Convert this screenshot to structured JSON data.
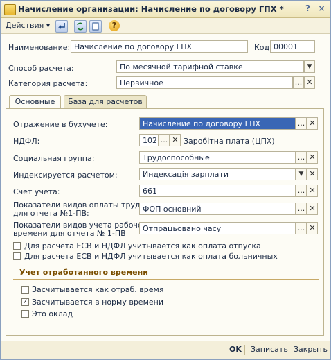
{
  "window": {
    "title": "Начисление организации: Начисление по договору ГПХ *",
    "controls": {
      "help": "?",
      "close": "×"
    }
  },
  "toolbar": {
    "actions_label": "Действия",
    "actions_arrow": "▾",
    "help_glyph": "?"
  },
  "header": {
    "name_label": "Наименование:",
    "name_value": "Начисление по договору ГПХ",
    "code_label": "Код:",
    "code_value": "00001",
    "calc_method_label": "Способ расчета:",
    "calc_method_value": "По месячной тарифной ставке",
    "calc_category_label": "Категория расчета:",
    "calc_category_value": "Первичное"
  },
  "tabs": [
    {
      "label": "Основные"
    },
    {
      "label": "База для расчетов"
    }
  ],
  "main": {
    "accounting_label": "Отражение в бухучете:",
    "accounting_value": "Начисление по договору ГПХ",
    "ndfl_label": "НДФЛ:",
    "ndfl_value": "102",
    "ndfl_desc": "Заробітна плата (ЦПХ)",
    "social_label": "Социальная группа:",
    "social_value": "Трудоспособные",
    "indexing_label": "Индексируется расчетом:",
    "indexing_value": "Индексація зарплати",
    "account_label": "Счет учета:",
    "account_value": "661",
    "pay_indicators_label_1": "Показатели видов оплаты труда",
    "pay_indicators_label_2": "для отчета №1-ПВ:",
    "pay_indicators_value": "ФОП основний",
    "time_indicators_label_1": "Показатели видов учета рабочего",
    "time_indicators_label_2": "времени для отчета № 1-ПВ",
    "time_indicators_value": "Отпрацьовано часу",
    "chk_vacation_label": "Для расчета ЕСВ и НДФЛ учитывается как оплата отпуска",
    "chk_sick_label": "Для расчета ЕСВ и НДФЛ учитывается как оплата больничных"
  },
  "worked_time": {
    "title": "Учет отработанного времени",
    "items": [
      {
        "label": "Засчитывается как отраб. время",
        "checked": false
      },
      {
        "label": "Засчитывается в норму времени",
        "checked": true
      },
      {
        "label": "Это оклад",
        "checked": false
      }
    ]
  },
  "footer": {
    "ok_label": "OK",
    "save_label": "Записать",
    "close_label": "Закрыть"
  },
  "glyphs": {
    "ellipsis": "...",
    "clear": "✕",
    "dropdown": "▼",
    "check": "✓"
  },
  "colors": {
    "selection": "#3a66b5",
    "section_title": "#7a4e00"
  }
}
